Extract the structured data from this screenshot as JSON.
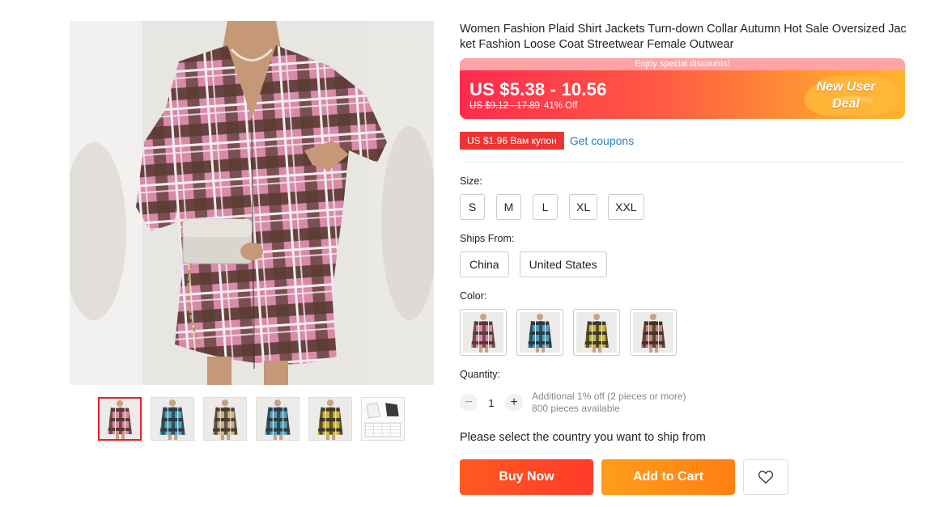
{
  "product": {
    "title": "Women Fashion Plaid Shirt Jackets Turn-down Collar Autumn Hot Sale Oversized Jacket Fashion Loose Coat Streetwear Female Outwear"
  },
  "gallery": {
    "thumbnails": [
      "pink plaid",
      "blue plaid",
      "beige plaid",
      "blue green plaid",
      "yellow plaid",
      "size chart"
    ],
    "active_index": 0
  },
  "price": {
    "banner": "Enjoy special discounts!",
    "current": "US $5.38 - 10.56",
    "original": "US $9.12 - 17.89",
    "discount": "41% Off",
    "deal_line1": "New User",
    "deal_line2": "Deal"
  },
  "coupon": {
    "tag": "US $1.96 Вам купон",
    "link": "Get coupons"
  },
  "size": {
    "label": "Size:",
    "options": [
      "S",
      "M",
      "L",
      "XL",
      "XXL"
    ]
  },
  "ships_from": {
    "label": "Ships From:",
    "options": [
      "China",
      "United States"
    ]
  },
  "color": {
    "label": "Color:",
    "swatches": [
      "pink-plaid",
      "blue-plaid",
      "yellow-plaid",
      "brown-plaid"
    ]
  },
  "quantity": {
    "label": "Quantity:",
    "minus": "−",
    "value": "1",
    "plus": "+",
    "note_line1": "Additional 1% off (2 pieces or more)",
    "note_line2": "800 pieces available"
  },
  "ship_message": "Please select the country you want to ship from",
  "actions": {
    "buy_now": "Buy Now",
    "add_to_cart": "Add to Cart"
  },
  "colors": {
    "accent_red": "#ff3a2b",
    "accent_orange": "#ff8a15",
    "link_blue": "#2a7fc4",
    "coupon_red": "#ed3434"
  }
}
